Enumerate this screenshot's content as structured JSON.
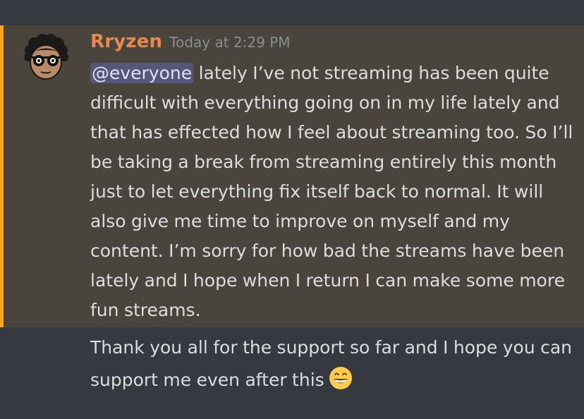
{
  "message": {
    "author": "Rryzen",
    "timestamp": "Today at 2:29 PM",
    "mention": "@everyone",
    "body": " lately I’ve not streaming has been quite difficult with everything going on in my life lately and that has effected how I feel about streaming too. So I’ll be taking a break from streaming entirely this month just to let everything fix itself back to normal. It will also give me time to improve on myself and my content. I’m sorry for how bad the streams have been lately and I hope when I return I can make some more fun streams.",
    "followup": "Thank you all for the support so far and I hope you can support me even after this",
    "emoji": "grinning-emoji"
  },
  "colors": {
    "background": "#36393f",
    "mention_highlight": "#49443c",
    "mention_bar": "#faa61a",
    "username": "#e8894a"
  }
}
